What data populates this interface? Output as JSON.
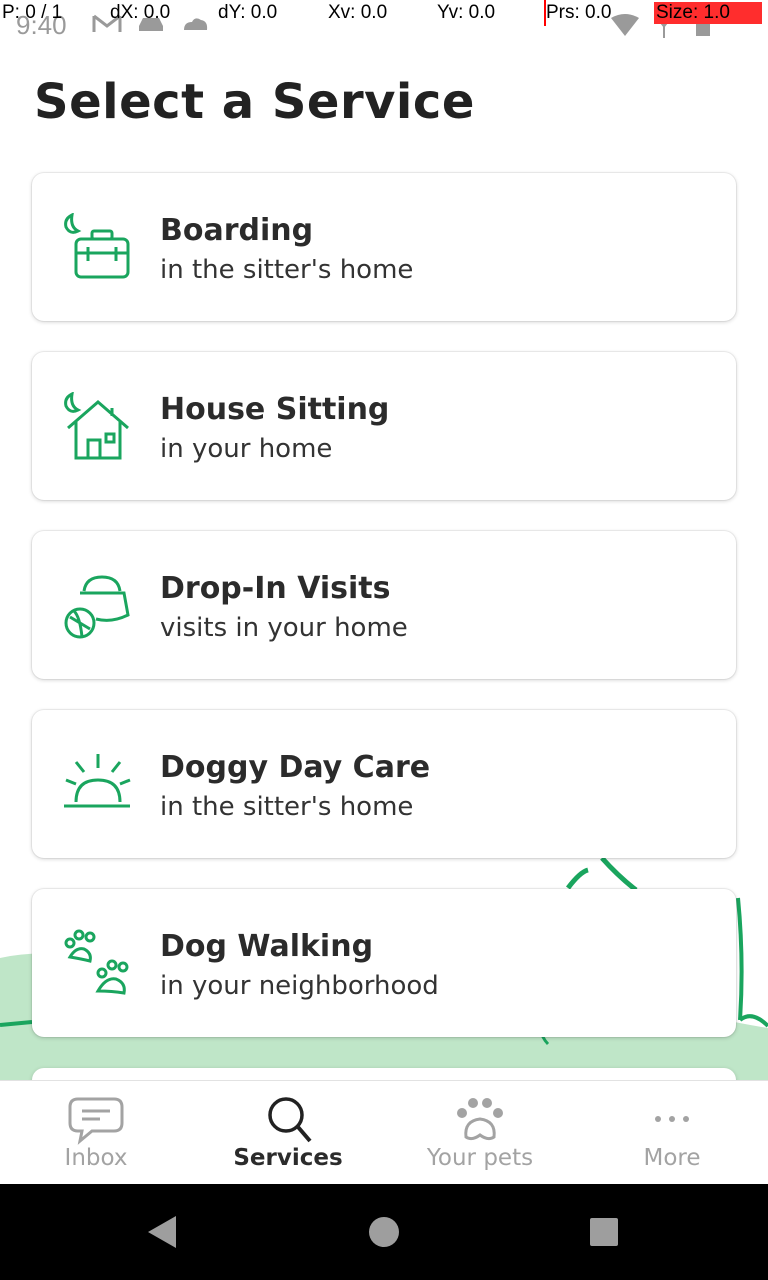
{
  "status_bar": {
    "time": "9:40",
    "icons": [
      "gmail-icon",
      "car-icon",
      "cloud-icon",
      "wifi-icon",
      "signal-icon",
      "battery-icon"
    ]
  },
  "debug_overlay": {
    "p": "P: 0 / 1",
    "dx": "dX: 0.0",
    "dy": "dY: 0.0",
    "xv": "Xv: 0.0",
    "yv": "Yv: 0.0",
    "prs": "Prs: 0.0",
    "size": "Size: 1.0"
  },
  "page": {
    "title": "Select a Service"
  },
  "services": [
    {
      "title": "Boarding",
      "subtitle": "in the sitter's home",
      "icon": "boarding-icon"
    },
    {
      "title": "House Sitting",
      "subtitle": "in your home",
      "icon": "house-sitting-icon"
    },
    {
      "title": "Drop-In Visits",
      "subtitle": "visits in your home",
      "icon": "drop-in-icon"
    },
    {
      "title": "Doggy Day Care",
      "subtitle": "in the sitter's home",
      "icon": "sun-icon"
    },
    {
      "title": "Dog Walking",
      "subtitle": "in your neighborhood",
      "icon": "paws-icon"
    }
  ],
  "bottom_nav": {
    "items": [
      {
        "label": "Inbox",
        "icon": "chat-bubble-icon",
        "active": false
      },
      {
        "label": "Services",
        "icon": "search-icon",
        "active": true
      },
      {
        "label": "Your pets",
        "icon": "paw-icon",
        "active": false
      },
      {
        "label": "More",
        "icon": "more-dots-icon",
        "active": false
      }
    ]
  },
  "colors": {
    "accent": "#1aa55e",
    "deco_bg": "#bfe6c8",
    "inactive": "#a3a3a3"
  }
}
